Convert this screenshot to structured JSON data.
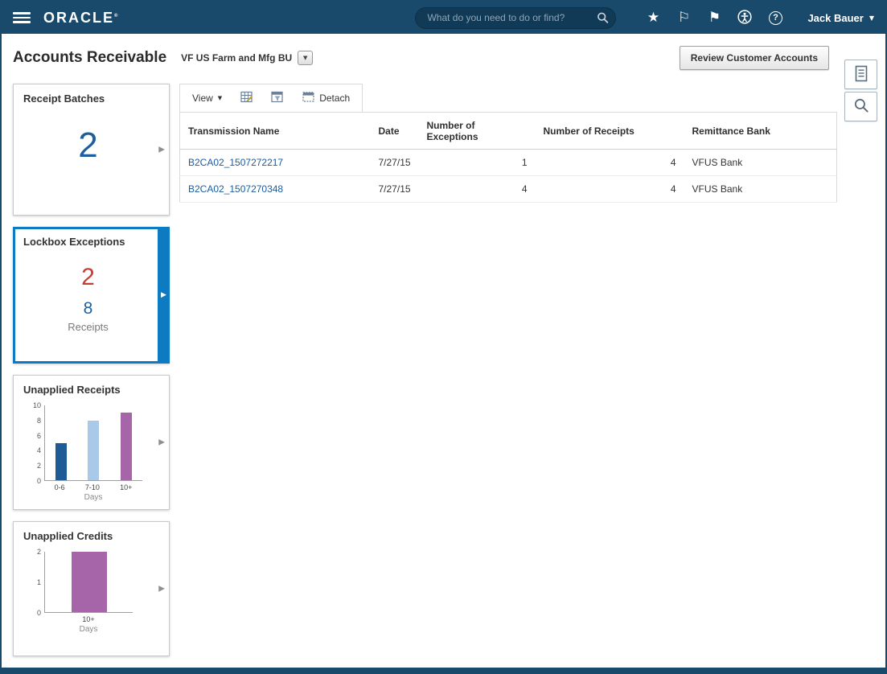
{
  "topbar": {
    "brand": "ORACLE",
    "brand_mark": "®",
    "search_placeholder": "What do you need to do or find?",
    "user_name": "Jack Bauer"
  },
  "icons": {
    "star": "★",
    "flag_outline": "⚐",
    "flag_filled": "⚑",
    "chevron_right": "▶",
    "caret_down": "▼",
    "help": "?"
  },
  "header": {
    "title": "Accounts Receivable",
    "business_unit": "VF US Farm and Mfg BU",
    "review_button_label": "Review Customer Accounts"
  },
  "tiles": {
    "receipt_batches": {
      "title": "Receipt Batches",
      "count": "2"
    },
    "lockbox_exceptions": {
      "title": "Lockbox Exceptions",
      "exception_count": "2",
      "receipt_count": "8",
      "receipts_label": "Receipts"
    }
  },
  "toolbar": {
    "view_label": "View",
    "detach_label": "Detach"
  },
  "table": {
    "columns": [
      "Transmission Name",
      "Date",
      "Number of Exceptions",
      "Number of Receipts",
      "Remittance Bank"
    ],
    "rows": [
      {
        "transmission_name": "B2CA02_1507272217",
        "date": "7/27/15",
        "exceptions": "1",
        "receipts": "4",
        "bank": "VFUS Bank"
      },
      {
        "transmission_name": "B2CA02_1507270348",
        "date": "7/27/15",
        "exceptions": "4",
        "receipts": "4",
        "bank": "VFUS Bank"
      }
    ]
  },
  "chart_data": [
    {
      "type": "bar",
      "title": "Unapplied Receipts",
      "categories": [
        "0-6",
        "7-10",
        "10+"
      ],
      "values": [
        5,
        8,
        9
      ],
      "colors": [
        "#1f5b94",
        "#a9c9e8",
        "#a565a8"
      ],
      "xlabel": "Days",
      "ylabel": "",
      "ylim": [
        0,
        10
      ],
      "yticks": [
        0,
        2,
        4,
        6,
        8,
        10
      ],
      "grid": false,
      "legend": "none"
    },
    {
      "type": "bar",
      "title": "Unapplied Credits",
      "categories": [
        "10+"
      ],
      "values": [
        2
      ],
      "colors": [
        "#a565a8"
      ],
      "xlabel": "Days",
      "ylabel": "",
      "ylim": [
        0,
        2
      ],
      "yticks": [
        0,
        1,
        2
      ],
      "grid": false,
      "legend": "none"
    }
  ],
  "colors": {
    "topbar_navy": "#1a4a6b",
    "accent_blue": "#0d7bc1",
    "count_blue": "#1d5f9e",
    "alert_red": "#c43c35",
    "link_blue": "#1a5b9e"
  }
}
